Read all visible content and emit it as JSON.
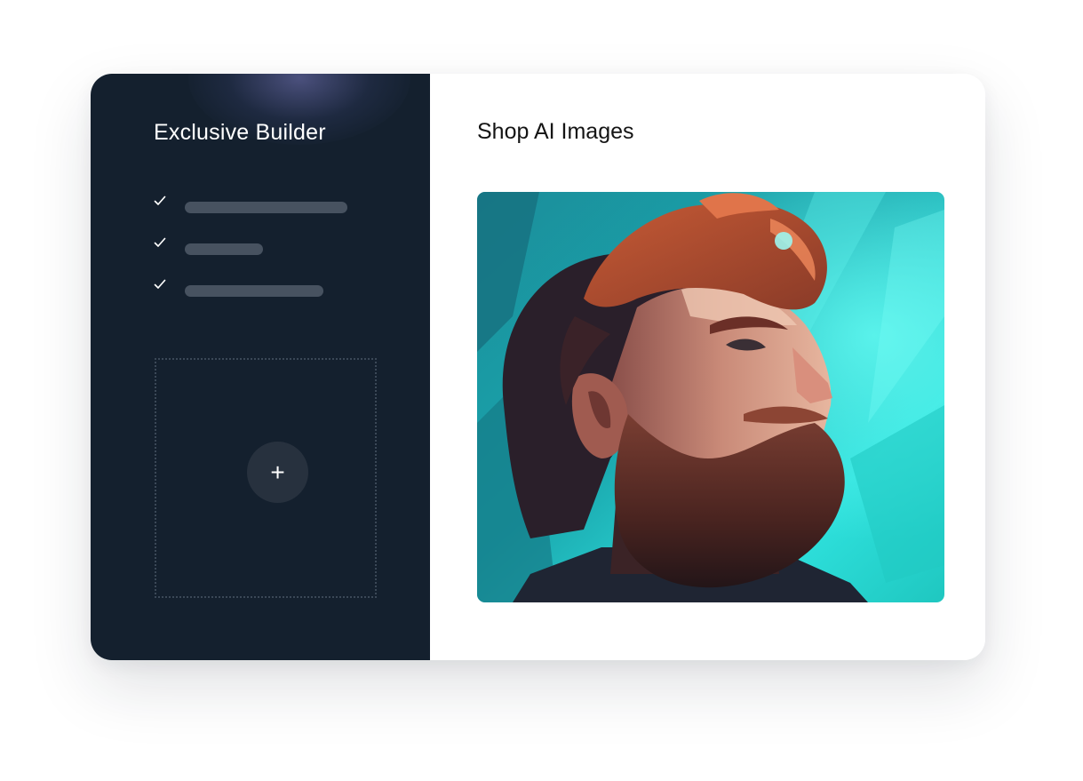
{
  "sidebar": {
    "title": "Exclusive Builder",
    "features": [
      {
        "icon": "check-icon"
      },
      {
        "icon": "check-icon"
      },
      {
        "icon": "check-icon"
      }
    ],
    "add_button": {
      "icon": "plus-icon",
      "label": "+"
    }
  },
  "main": {
    "title": "Shop AI Images",
    "image": {
      "subject": "illustrated portrait"
    }
  },
  "colors": {
    "sidebar_bg": "#14202e",
    "placeholder_bar": "#475260",
    "accent_teal": "#2ee6e0"
  }
}
